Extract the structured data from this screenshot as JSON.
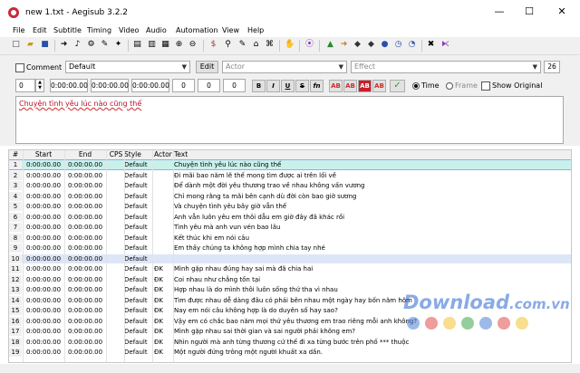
{
  "window": {
    "title": "new 1.txt - Aegisub 3.2.2",
    "minimize": "—",
    "maximize": "☐",
    "close": "✕"
  },
  "menu": [
    "File",
    "Edit",
    "Subtitle",
    "Timing",
    "Video",
    "Audio",
    "Automation",
    "View",
    "Help"
  ],
  "edit": {
    "comment_label": "Comment",
    "style_value": "Default",
    "edit_button": "Edit",
    "actor_placeholder": "Actor",
    "effect_placeholder": "Effect",
    "char_count": "26",
    "layer": "0",
    "start_time": "0:00:00.00",
    "end_time": "0:00:00.00",
    "duration": "0:00:00.00",
    "margin_l": "0",
    "margin_r": "0",
    "margin_v": "0",
    "format_buttons": [
      "B",
      "I",
      "U",
      "S",
      "fn",
      "AB",
      "AB",
      "AB",
      "AB"
    ],
    "commit_icon": "✓",
    "time_label": "Time",
    "frame_label": "Frame",
    "show_original_label": "Show Original",
    "text": "Chuyện tình yêu lúc nào cũng thế"
  },
  "grid": {
    "columns": [
      "#",
      "Start",
      "End",
      "CPS",
      "Style",
      "Actor",
      "Text"
    ],
    "rows": [
      {
        "n": "1",
        "start": "0:00:00.00",
        "end": "0:00:00.00",
        "style": "Default",
        "actor": "",
        "text": "Chuyện tình yêu lúc nào cũng thế"
      },
      {
        "n": "2",
        "start": "0:00:00.00",
        "end": "0:00:00.00",
        "style": "Default",
        "actor": "",
        "text": "Đi mãi bao năm lẽ thế mong tìm được ai trên lối về"
      },
      {
        "n": "3",
        "start": "0:00:00.00",
        "end": "0:00:00.00",
        "style": "Default",
        "actor": "",
        "text": "Để dành một đời yêu thương trao về nhau không vấn vương"
      },
      {
        "n": "4",
        "start": "0:00:00.00",
        "end": "0:00:00.00",
        "style": "Default",
        "actor": "",
        "text": "Chỉ mong rằng ta mãi bên cạnh dù đời còn bao giờ sương"
      },
      {
        "n": "5",
        "start": "0:00:00.00",
        "end": "0:00:00.00",
        "style": "Default",
        "actor": "",
        "text": "Và chuyện tình yêu bây giờ vẫn thế"
      },
      {
        "n": "6",
        "start": "0:00:00.00",
        "end": "0:00:00.00",
        "style": "Default",
        "actor": "",
        "text": "Anh vẫn luôn yêu em thôi dẫu em giờ đây đã khác rồi"
      },
      {
        "n": "7",
        "start": "0:00:00.00",
        "end": "0:00:00.00",
        "style": "Default",
        "actor": "",
        "text": "Tình yêu mà anh vun vén bao lâu"
      },
      {
        "n": "8",
        "start": "0:00:00.00",
        "end": "0:00:00.00",
        "style": "Default",
        "actor": "",
        "text": "Kết thúc khi em nói câu"
      },
      {
        "n": "9",
        "start": "0:00:00.00",
        "end": "0:00:00.00",
        "style": "Default",
        "actor": "",
        "text": "Em thấy chúng ta không hợp mình chia tay nhé"
      },
      {
        "n": "10",
        "start": "0:00:00.00",
        "end": "0:00:00.00",
        "style": "Default",
        "actor": "",
        "text": ""
      },
      {
        "n": "11",
        "start": "0:00:00.00",
        "end": "0:00:00.00",
        "style": "Default",
        "actor": "ĐK",
        "text": "Mình gặp nhau đúng hay sai mà đã chia hai"
      },
      {
        "n": "12",
        "start": "0:00:00.00",
        "end": "0:00:00.00",
        "style": "Default",
        "actor": "ĐK",
        "text": "Coi nhau như chẳng tồn tại"
      },
      {
        "n": "13",
        "start": "0:00:00.00",
        "end": "0:00:00.00",
        "style": "Default",
        "actor": "ĐK",
        "text": "Hợp nhau là do mình thôi luôn sống thứ tha vì nhau"
      },
      {
        "n": "14",
        "start": "0:00:00.00",
        "end": "0:00:00.00",
        "style": "Default",
        "actor": "ĐK",
        "text": "Tìm được nhau dễ dàng đâu có phải bên nhau một ngày hay bốn năm hôm"
      },
      {
        "n": "15",
        "start": "0:00:00.00",
        "end": "0:00:00.00",
        "style": "Default",
        "actor": "ĐK",
        "text": "Nay em nói câu không hợp là do duyên số hay sao?"
      },
      {
        "n": "16",
        "start": "0:00:00.00",
        "end": "0:00:00.00",
        "style": "Default",
        "actor": "ĐK",
        "text": "Vậy em có chắc bao năm mọi thứ yêu thương em trao riêng mỗi anh không?"
      },
      {
        "n": "17",
        "start": "0:00:00.00",
        "end": "0:00:00.00",
        "style": "Default",
        "actor": "ĐK",
        "text": "Mình gặp nhau sai thời gian và sai người phải không em?"
      },
      {
        "n": "18",
        "start": "0:00:00.00",
        "end": "0:00:00.00",
        "style": "Default",
        "actor": "ĐK",
        "text": "Nhìn người mà anh từng thương cứ thế đi xa từng bước trên phố *** thuộc"
      },
      {
        "n": "19",
        "start": "0:00:00.00",
        "end": "0:00:00.00",
        "style": "Default",
        "actor": "ĐK",
        "text": "Một người đứng trông một người khuất xa dần."
      }
    ]
  },
  "watermark": {
    "main": "Download",
    "suffix": ".com.vn"
  },
  "colors": {
    "selected_row": "#c9f1ec",
    "highlight_row": "#dde6f6",
    "text_accent": "#b8122e",
    "commit": "#2e9d2e"
  }
}
